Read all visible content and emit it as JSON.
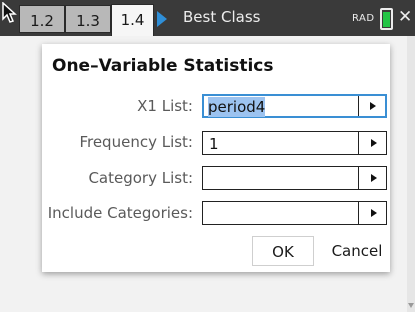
{
  "topbar": {
    "tabs": [
      {
        "label": "1.2",
        "active": false
      },
      {
        "label": "1.3",
        "active": false
      },
      {
        "label": "1.4",
        "active": true
      }
    ],
    "document_title": "Best Class",
    "angle_mode": "RAD",
    "battery_color": "#23c446",
    "close_icon": "close-icon",
    "play_icon": "play-icon",
    "accent_color": "#2f8fd8"
  },
  "dialog": {
    "title": "One–Variable Statistics",
    "fields": [
      {
        "label": "X1 List:",
        "value": "period4",
        "focused": true
      },
      {
        "label": "Frequency List:",
        "value": "1",
        "focused": false
      },
      {
        "label": "Category List:",
        "value": "",
        "focused": false
      },
      {
        "label": "Include Categories:",
        "value": "",
        "focused": false
      }
    ],
    "ok_label": "OK",
    "cancel_label": "Cancel"
  }
}
